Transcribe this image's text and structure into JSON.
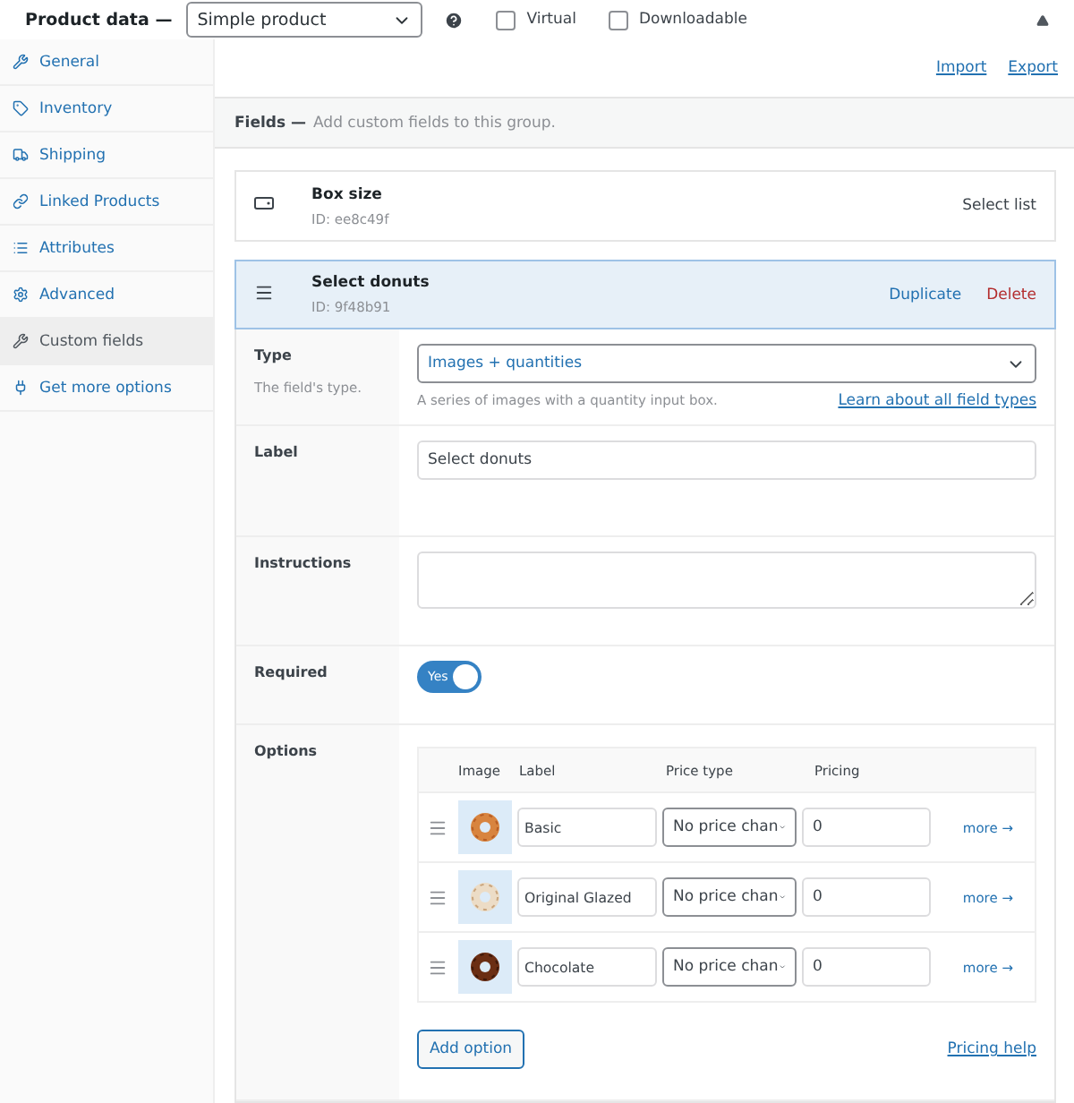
{
  "header": {
    "title": "Product data —",
    "product_type": "Simple product",
    "virtual": {
      "label": "Virtual",
      "checked": false
    },
    "downloadable": {
      "label": "Downloadable",
      "checked": false
    }
  },
  "sidebar": {
    "items": [
      {
        "label": "General",
        "selected": false
      },
      {
        "label": "Inventory",
        "selected": false
      },
      {
        "label": "Shipping",
        "selected": false
      },
      {
        "label": "Linked Products",
        "selected": false
      },
      {
        "label": "Attributes",
        "selected": false
      },
      {
        "label": "Advanced",
        "selected": false
      },
      {
        "label": "Custom fields",
        "selected": true
      },
      {
        "label": "Get more options",
        "selected": false
      }
    ]
  },
  "toolbar": {
    "links": [
      "Import",
      "Export"
    ]
  },
  "fields_bar": {
    "title": "Fields —",
    "hint": "Add custom fields to this group."
  },
  "fields": [
    {
      "name": "Box size",
      "id": "ID: ee8c49f",
      "type_label": "Select list",
      "expanded": false
    },
    {
      "name": "Select donuts",
      "id": "ID: 9f48b91",
      "expanded": true,
      "actions": [
        "Duplicate",
        "Delete"
      ]
    }
  ],
  "editor": {
    "type": {
      "label": "Type",
      "description": "The field's type.",
      "value": "Images + quantities",
      "hint": "A series of images with a quantity input box.",
      "link": "Learn about all field types"
    },
    "label": {
      "label": "Label",
      "value": "Select donuts"
    },
    "instructions": {
      "label": "Instructions"
    },
    "required": {
      "label": "Required",
      "on": true,
      "text": "Yes"
    },
    "options": {
      "label": "Options",
      "columns": [
        "Image",
        "Label",
        "Price type",
        "Pricing"
      ],
      "rows": [
        {
          "label": "Basic",
          "price_type": "No price chan",
          "pricing": "0",
          "more": "more →"
        },
        {
          "label": "Original Glazed",
          "price_type": "No price chan",
          "pricing": "0",
          "more": "more →"
        },
        {
          "label": "Chocolate",
          "price_type": "No price chan",
          "pricing": "0",
          "more": "more →"
        }
      ],
      "add_button": "Add option",
      "help_link": "Pricing help"
    }
  }
}
